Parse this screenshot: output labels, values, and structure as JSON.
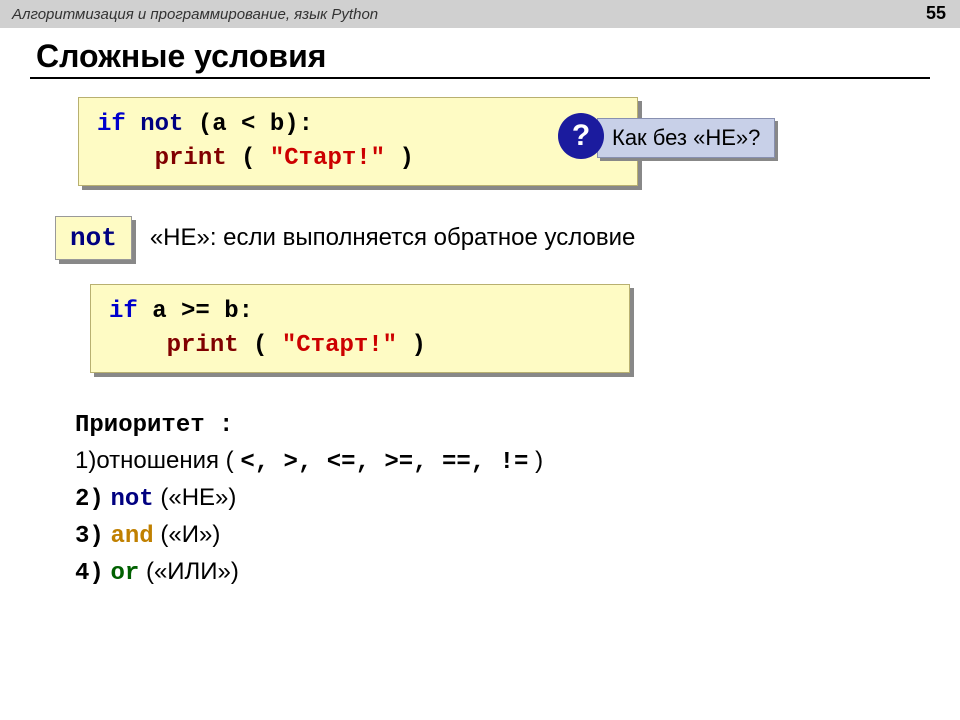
{
  "header": {
    "title": "Алгоритмизация и программирование, язык Python",
    "page_number": "55"
  },
  "slide_title": "Сложные условия",
  "code1": {
    "if": "if",
    "not": "not",
    "cond": "(a < b):",
    "print": "print",
    "paren_open": "(",
    "str": "\"Старт!\"",
    "paren_close": ")"
  },
  "question": {
    "mark": "?",
    "text": "Как без «НЕ»?"
  },
  "not_row": {
    "badge": "not",
    "desc": "«НЕ»: если выполняется обратное условие"
  },
  "code2": {
    "if": "if",
    "cond": "a >= b:",
    "print": "print",
    "paren_open": "(",
    "str": "\"Старт!\"",
    "paren_close": ")"
  },
  "priority": {
    "title": "Приоритет :",
    "line1_prefix": "1)отношения (",
    "line1_ops": "<, >, <=, >=, ==, !=",
    "line1_suffix": ")",
    "line2_num": "2)",
    "line2_kw": "not",
    "line2_desc": " («НЕ»)",
    "line3_num": "3)",
    "line3_kw": "and",
    "line3_desc": " («И»)",
    "line4_num": "4)",
    "line4_kw": "or",
    "line4_desc": " («ИЛИ»)"
  }
}
